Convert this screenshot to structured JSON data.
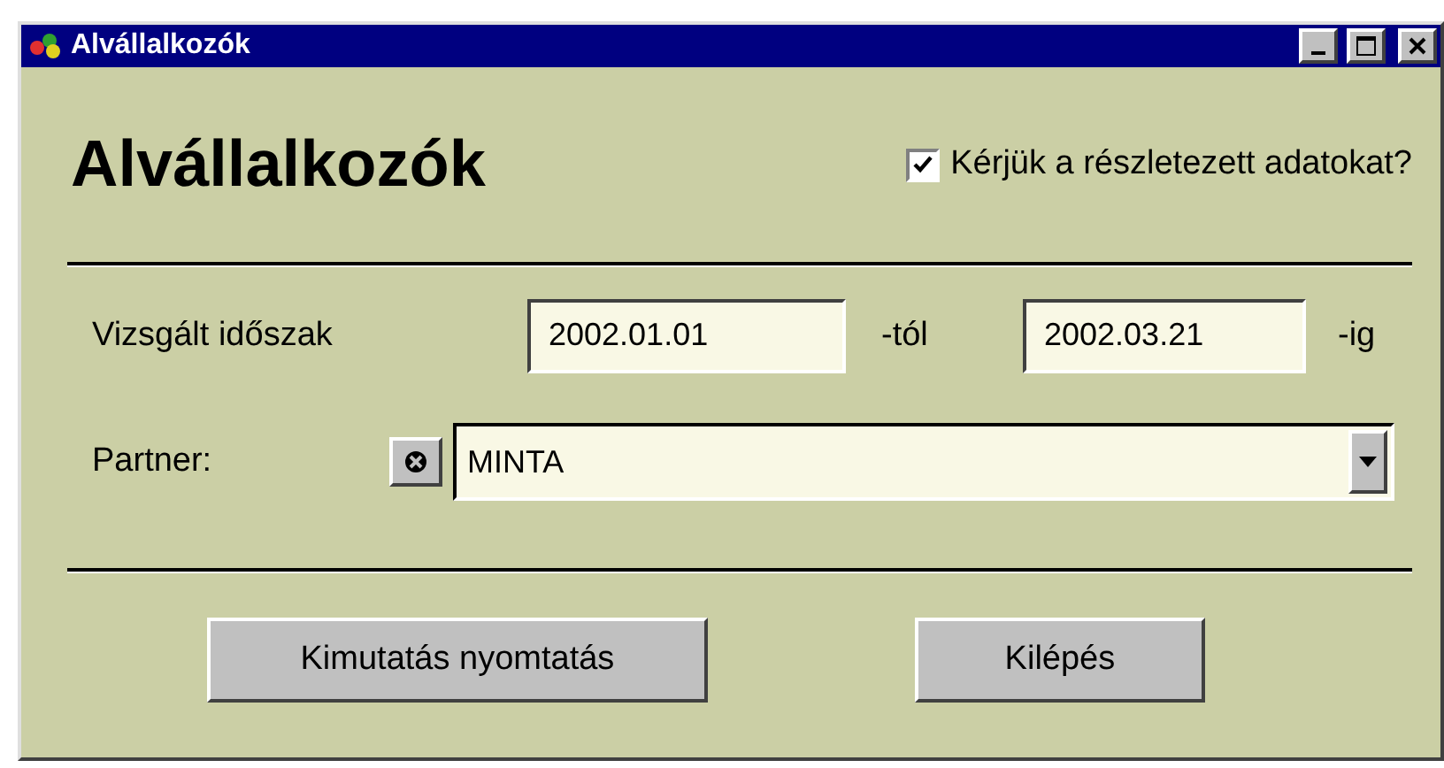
{
  "window": {
    "title": "Alvállalkozók"
  },
  "heading": "Alvállalkozók",
  "detail_checkbox": {
    "label": "Kérjük a részletezett adatokat?",
    "checked": true
  },
  "period": {
    "label": "Vizsgált időszak",
    "from": "2002.01.01",
    "from_suffix": "-tól",
    "to": "2002.03.21",
    "to_suffix": "-ig"
  },
  "partner": {
    "label": "Partner:",
    "value": "MINTA"
  },
  "buttons": [
    "Kimutatás nyomtatás",
    "Kilépés"
  ]
}
